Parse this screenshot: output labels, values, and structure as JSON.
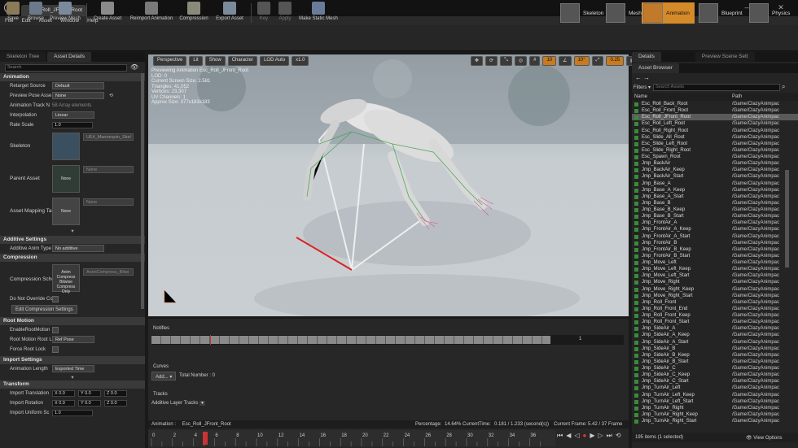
{
  "window": {
    "doc_tab": "Esc_Roll_JFront_Root"
  },
  "menu": [
    "File",
    "Edit",
    "Asset",
    "Window",
    "Help"
  ],
  "toolbar": [
    {
      "label": "Save",
      "icon": "save-icon"
    },
    {
      "label": "Browse",
      "icon": "browse-icon"
    },
    {
      "label": "Preview Mesh",
      "icon": "preview-mesh-icon"
    },
    {
      "label": "Create Asset",
      "icon": "create-asset-icon"
    },
    {
      "label": "Reimport Animation",
      "icon": "reimport-icon"
    },
    {
      "label": "Compression",
      "icon": "compression-icon"
    },
    {
      "label": "Export Asset",
      "icon": "export-icon"
    },
    {
      "label": "Key",
      "icon": "key-icon"
    },
    {
      "label": "Apply",
      "icon": "apply-icon"
    },
    {
      "label": "Make Static Mesh",
      "icon": "static-mesh-icon"
    }
  ],
  "modes": [
    "Skeleton",
    "Mesh",
    "Animation",
    "Blueprint",
    "Physics"
  ],
  "left": {
    "tabs": [
      "Skeleton Tree",
      "Asset Details"
    ],
    "search_placeholder": "Search",
    "animation": {
      "header": "Animation",
      "retarget_source_label": "Retarget Source",
      "retarget_source_value": "Default",
      "preview_pose_label": "Preview Pose Asse",
      "preview_pose_value": "None",
      "track_names_label": "Animation Track N",
      "track_names_value": "58 Array elements",
      "interpolation_label": "Interpolation",
      "interpolation_value": "Linear",
      "rate_scale_label": "Rate Scale",
      "rate_scale_value": "1.0",
      "skeleton_label": "Skeleton",
      "skeleton_value": "UE4_Mannequin_Skel",
      "parent_asset_label": "Parent Asset",
      "parent_asset_thumb": "None",
      "parent_asset_value": "None",
      "mapping_label": "Asset Mapping Tab",
      "mapping_thumb": "None",
      "mapping_value": "None"
    },
    "additive": {
      "header": "Additive Settings",
      "type_label": "Additive Anim Type",
      "type_value": "No additive"
    },
    "compression": {
      "header": "Compression",
      "scheme_label": "Compression Sche",
      "scheme_thumb": "Anim Compress Bitwise Compress Only",
      "scheme_value": "AnimCompress_Bitwi",
      "dont_override_label": "Do Not Override Co",
      "edit_button": "Edit Compression Settings"
    },
    "root_motion": {
      "header": "Root Motion",
      "enable_label": "EnableRootMotion",
      "lock_label": "Root Motion Root L",
      "lock_value": "Ref Pose",
      "force_label": "Force Root Lock"
    },
    "import": {
      "header": "Import Settings",
      "length_label": "Animation Length",
      "length_value": "Exported Time"
    },
    "transform": {
      "header": "Transform",
      "translation_label": "Import Translation",
      "rotation_label": "Import Rotation",
      "scale_label": "Import Uniform Sc",
      "x": "X 0.0",
      "y": "Y 0.0",
      "z": "Z 0.0",
      "scale_value": "1.0"
    }
  },
  "viewport": {
    "buttons": [
      "Perspective",
      "Lit",
      "Show",
      "Character",
      "LOD Auto",
      "x1.0"
    ],
    "info": [
      "Previewing Animation Esc_Roll_JFront_Root",
      "LOD: 0",
      "Current Screen Size: 2.581",
      "Triangles: 41,052",
      "Vertices: 23,307",
      "UV Channels: 1",
      "Approx Size: 377x183x183"
    ],
    "right_controls": [
      "10",
      "10°",
      "0.25",
      "4"
    ]
  },
  "timeline": {
    "notifies": "Notifies",
    "track_number": "1",
    "curves": "Curves",
    "add_button": "Add...",
    "total_number": "Total Number : 0",
    "tracks": "Tracks",
    "additive_tracks": "Additive Layer Tracks",
    "status": {
      "animation": "Animation :",
      "anim_name": "Esc_Roll_JFront_Root",
      "percentage": "Percentage:",
      "pct_value": "14.64% CurrentTime:",
      "time_value": "0.181 / 1.233 (second(s))",
      "frame": "Current Frame:",
      "frame_value": "5.42 / 37 Frame"
    },
    "ruler": [
      "0",
      "2",
      "4",
      "6",
      "8",
      "10",
      "12",
      "14",
      "16",
      "18",
      "20",
      "22",
      "24",
      "26",
      "28",
      "30",
      "32",
      "34",
      "36"
    ]
  },
  "right": {
    "tabs": [
      "Details",
      "Preview Scene Sett"
    ],
    "browser_tab": "Asset Browser",
    "filters": "Filters",
    "search_placeholder": "Search Assets",
    "col_name": "Name",
    "col_path": "Path",
    "assets": [
      "Esc_Roll_Back_Root",
      "Esc_Roll_Front_Root",
      "Esc_Roll_JFront_Root",
      "Esc_Roll_Left_Root",
      "Esc_Roll_Right_Root",
      "Esc_Slide_All_Root",
      "Esc_Slide_Left_Root",
      "Esc_Slide_Right_Root",
      "Esc_Spawn_Root",
      "Jmp_BackAir",
      "Jmp_BackAir_Keep",
      "Jmp_BackAir_Start",
      "Jmp_Base_A",
      "Jmp_Base_A_Keep",
      "Jmp_Base_A_Start",
      "Jmp_Base_B",
      "Jmp_Base_B_Keep",
      "Jmp_Base_B_Start",
      "Jmp_FrontAir_A",
      "Jmp_FrontAir_A_Keep",
      "Jmp_FrontAir_A_Start",
      "Jmp_FrontAir_B",
      "Jmp_FrontAir_B_Keep",
      "Jmp_FrontAir_B_Start",
      "Jmp_Move_Left",
      "Jmp_Move_Left_Keep",
      "Jmp_Move_Left_Start",
      "Jmp_Move_Right",
      "Jmp_Move_Right_Keep",
      "Jmp_Move_Right_Start",
      "Jmp_Roll_Front",
      "Jmp_Roll_Front_End",
      "Jmp_Roll_Front_Keep",
      "Jmp_Roll_Front_Start",
      "Jmp_SideAir_A",
      "Jmp_SideAir_A_Keep",
      "Jmp_SideAir_A_Start",
      "Jmp_SideAir_B",
      "Jmp_SideAir_B_Keep",
      "Jmp_SideAir_B_Start",
      "Jmp_SideAir_C",
      "Jmp_SideAir_C_Keep",
      "Jmp_SideAir_C_Start",
      "Jmp_TurnAir_Left",
      "Jmp_TurnAir_Left_Keep",
      "Jmp_TurnAir_Left_Start",
      "Jmp_TurnAir_Right",
      "Jmp_TurnAir_Right_Keep",
      "Jmp_TurnAir_Right_Start"
    ],
    "asset_path": "/Game/ClazyAnimpac",
    "selected": "Esc_Roll_JFront_Root",
    "count": "195 items (1 selected)",
    "view_options": "View Options"
  }
}
